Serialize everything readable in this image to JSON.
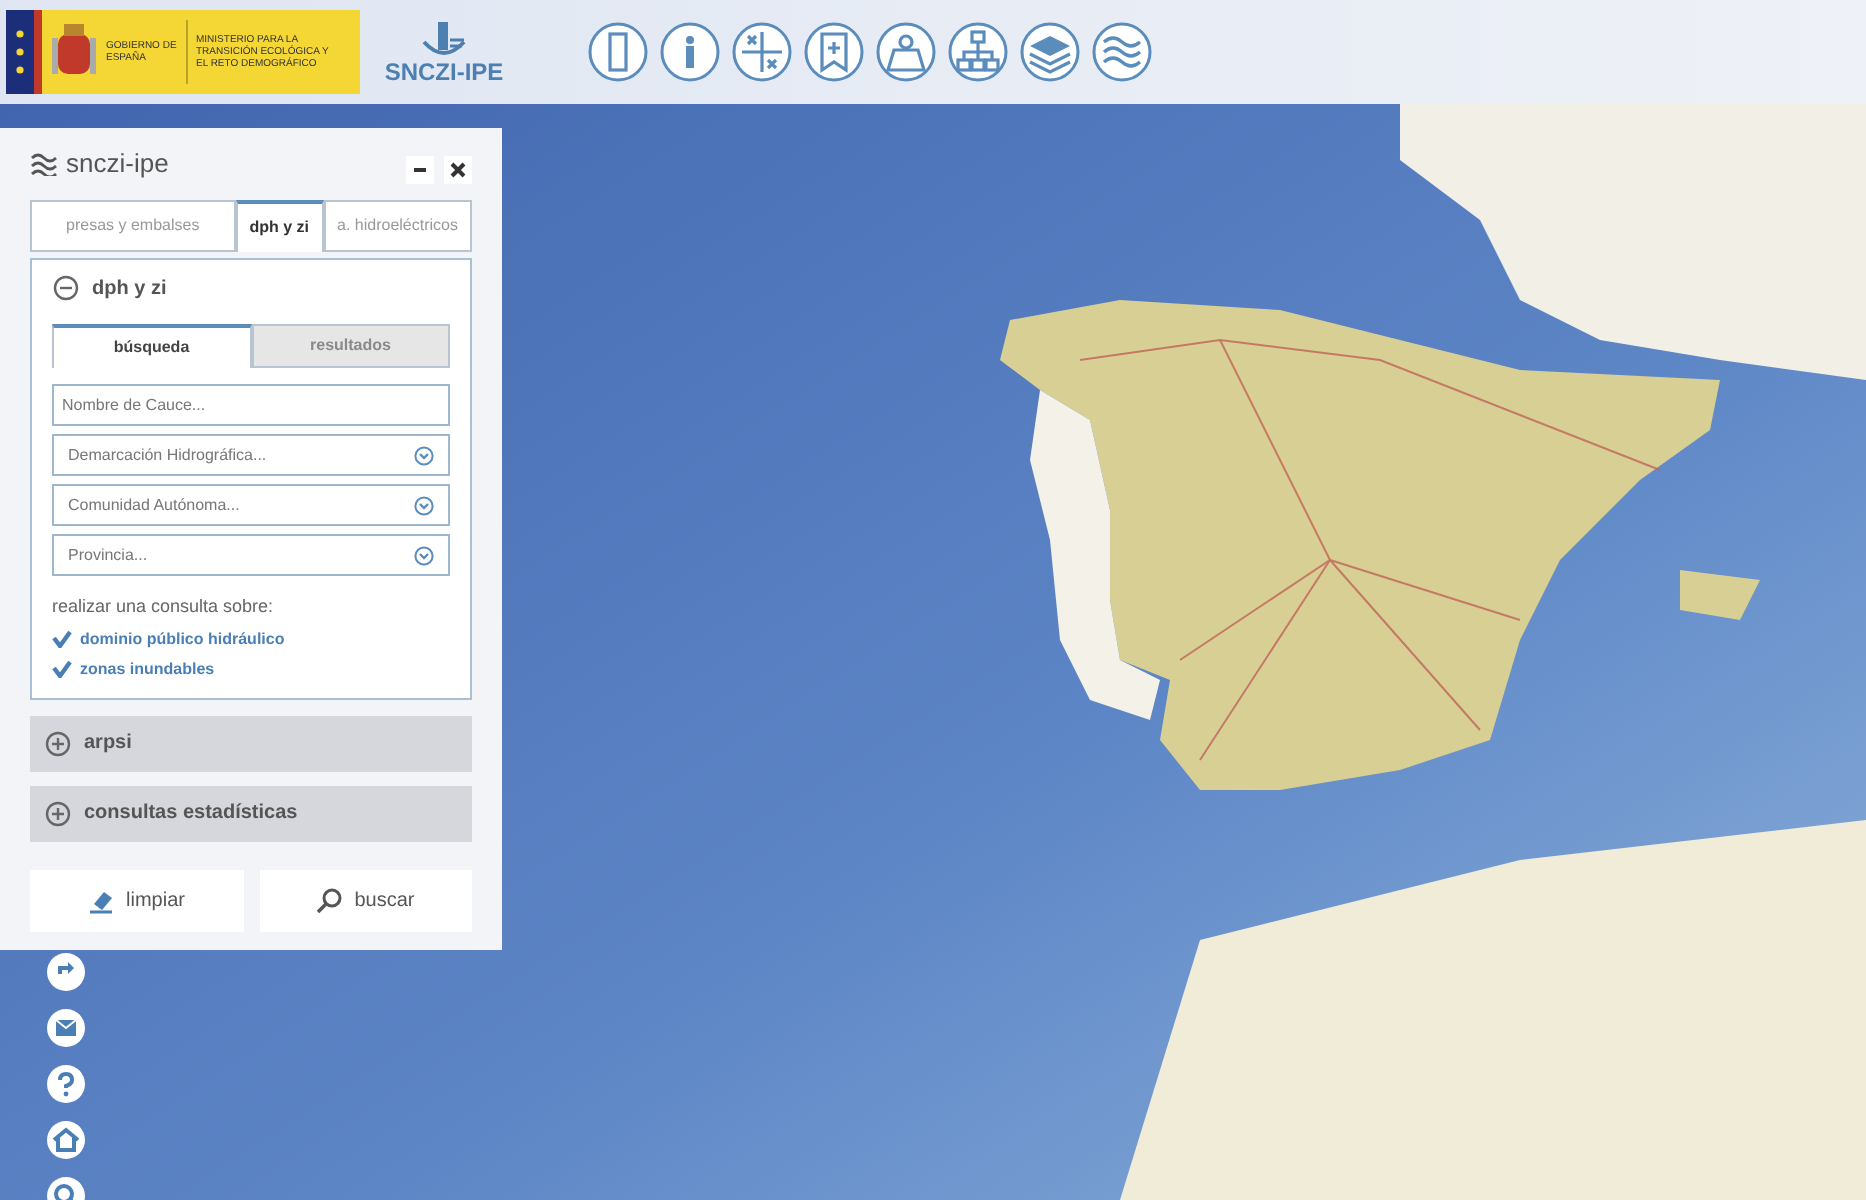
{
  "header": {
    "government": "GOBIERNO DE ESPAÑA",
    "ministry": "MINISTERIO PARA LA TRANSICIÓN ECOLÓGICA Y EL RETO DEMOGRÁFICO",
    "app_logo": "SNCZI-IPE"
  },
  "panel": {
    "title": "snczi-ipe",
    "tabs": [
      {
        "label": "presas y embalses",
        "selected": false
      },
      {
        "label": "dph y zi",
        "selected": true
      },
      {
        "label": "a. hidroeléctricos",
        "selected": false
      }
    ],
    "sections": [
      {
        "title": "dph y zi",
        "expanded": true,
        "subtabs": [
          {
            "label": "búsqueda",
            "selected": true
          },
          {
            "label": "resultados",
            "selected": false
          }
        ],
        "fields": [
          {
            "kind": "text",
            "placeholder": "Nombre de Cauce..."
          },
          {
            "kind": "select",
            "placeholder": "Demarcación Hidrográfica..."
          },
          {
            "kind": "select",
            "placeholder": "Comunidad Autónoma..."
          },
          {
            "kind": "select",
            "placeholder": "Provincia..."
          }
        ],
        "query_label": "realizar una consulta sobre:",
        "options": [
          {
            "label": "dominio público hidráulico",
            "checked": true
          },
          {
            "label": "zonas inundables",
            "checked": true
          }
        ]
      },
      {
        "title": "arpsi",
        "expanded": false
      },
      {
        "title": "consultas estadísticas",
        "expanded": false
      }
    ],
    "buttons": [
      {
        "kind": "clear",
        "label": "limpiar"
      },
      {
        "kind": "search",
        "label": "buscar"
      }
    ]
  }
}
